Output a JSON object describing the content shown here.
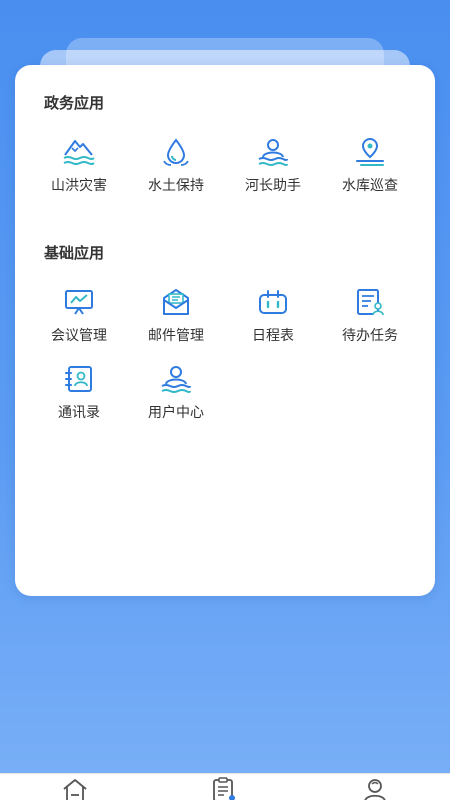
{
  "sections": [
    {
      "title": "政务应用",
      "apps": [
        {
          "label": "山洪灾害",
          "icon": "mountain-flood-icon"
        },
        {
          "label": "水土保持",
          "icon": "water-drop-icon"
        },
        {
          "label": "河长助手",
          "icon": "river-chief-icon"
        },
        {
          "label": "水库巡查",
          "icon": "location-pin-icon"
        }
      ]
    },
    {
      "title": "基础应用",
      "apps": [
        {
          "label": "会议管理",
          "icon": "presentation-board-icon"
        },
        {
          "label": "邮件管理",
          "icon": "mail-icon"
        },
        {
          "label": "日程表",
          "icon": "calendar-icon"
        },
        {
          "label": "待办任务",
          "icon": "task-list-icon"
        },
        {
          "label": "通讯录",
          "icon": "contacts-icon"
        },
        {
          "label": "用户中心",
          "icon": "user-center-icon"
        }
      ]
    }
  ],
  "tabs": [
    {
      "icon": "home-icon"
    },
    {
      "icon": "clipboard-icon"
    },
    {
      "icon": "user-icon"
    }
  ],
  "colors": {
    "accent": "#2f7be0",
    "teal": "#33b8c8",
    "background": "#4a8ff0"
  }
}
